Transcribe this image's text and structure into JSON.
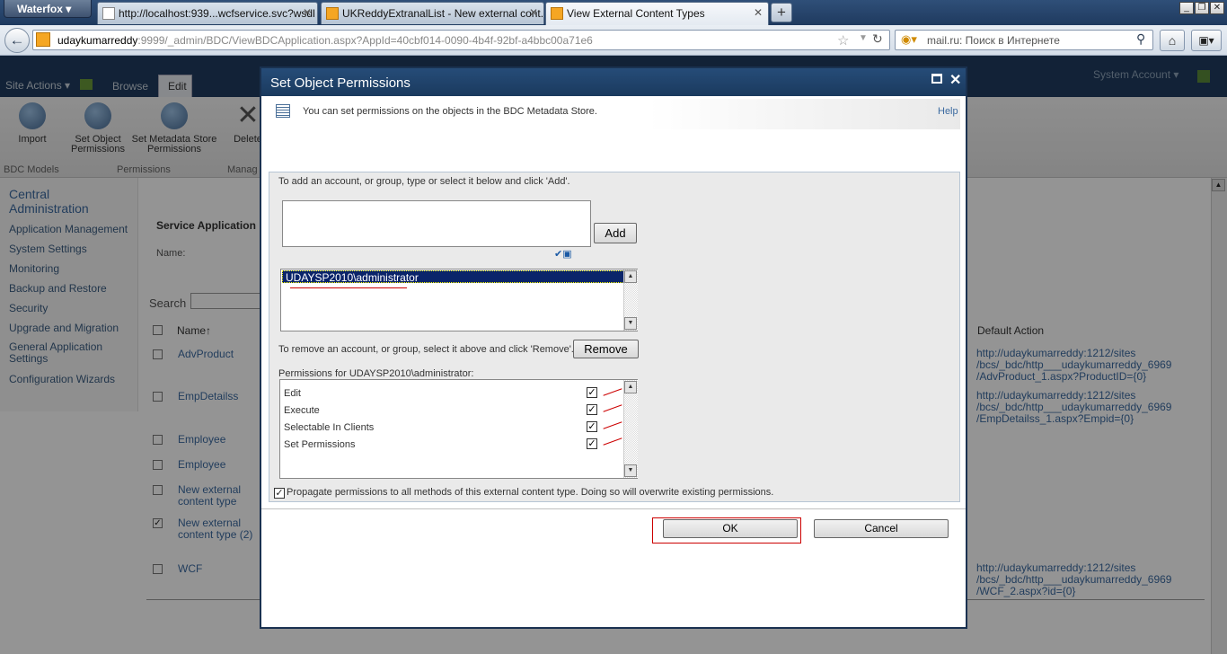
{
  "browser": {
    "app_name": "Waterfox",
    "tabs": [
      {
        "label": "http://localhost:939...wcfservice.svc?wsdl"
      },
      {
        "label": "UKReddyExtranalList - New external cont..."
      },
      {
        "label": "View External Content Types"
      }
    ],
    "url_host": "udaykumarreddy",
    "url_rest": ":9999/_admin/BDC/ViewBDCApplication.aspx?AppId=40cbf014-0090-4b4f-92bf-a4bbc00a71e6",
    "search_placeholder": "mail.ru: Поиск в Интернете"
  },
  "page": {
    "top_links": {
      "site_actions": "Site Actions ▾",
      "browse": "Browse",
      "edit": "Edit"
    },
    "system_account": "System Account ▾",
    "ribbon_buttons": [
      {
        "label": "Import"
      },
      {
        "label": "Set Object Permissions"
      },
      {
        "label": "Set Metadata Store Permissions"
      },
      {
        "label": "Delete"
      }
    ],
    "ribbon_groups": [
      "BDC Models",
      "Permissions",
      "Manag"
    ],
    "leftnav": {
      "heading": "Central Administration",
      "items": [
        "Application Management",
        "System Settings",
        "Monitoring",
        "Backup and Restore",
        "Security",
        "Upgrade and Migration",
        "General Application Settings",
        "Configuration Wizards"
      ]
    },
    "service_app_title": "Service Application I",
    "name_label": "Name:",
    "search_label": "Search",
    "column_name": "Name↑",
    "column_default_action": "Default Action",
    "rows": [
      {
        "name": "AdvProduct",
        "checked": false,
        "action": "http://udaykumarreddy:1212/sites/bcs/_bdc/http___udaykumarreddy_6969/AdvProduct_1.aspx?ProductID={0}"
      },
      {
        "name": "EmpDetailss",
        "checked": false,
        "action": "http://udaykumarreddy:1212/sites/bcs/_bdc/http___udaykumarreddy_6969/EmpDetailss_1.aspx?Empid={0}"
      },
      {
        "name": "Employee",
        "checked": false,
        "action": ""
      },
      {
        "name": "Employee",
        "checked": false,
        "action": ""
      },
      {
        "name": "New external content type",
        "checked": false,
        "action": ""
      },
      {
        "name": "New external content type (2)",
        "checked": true,
        "action": ""
      },
      {
        "name": "WCF",
        "checked": false,
        "action": "http://udaykumarreddy:1212/sites/bcs/_bdc/http___udaykumarreddy_6969/WCF_2.aspx?id={0}"
      }
    ],
    "action_lines": [
      [
        "http://udaykumarreddy:1212/sites",
        "/bcs/_bdc/http___udaykumarreddy_6969",
        "/AdvProduct_1.aspx?ProductID={0}"
      ],
      [
        "http://udaykumarreddy:1212/sites",
        "/bcs/_bdc/http___udaykumarreddy_6969",
        "/EmpDetailss_1.aspx?Empid={0}"
      ],
      [
        "http://udaykumarreddy:1212/sites",
        "/bcs/_bdc/http___udaykumarreddy_6969",
        "/WCF_2.aspx?id={0}"
      ]
    ]
  },
  "dialog": {
    "title": "Set Object Permissions",
    "info_text": "You can set permissions on the objects in the BDC Metadata Store.",
    "help_label": "Help",
    "add_instructions": "To add an account, or group, type or select it below and click 'Add'.",
    "account_input_value": "",
    "add_label": "Add",
    "users": [
      "UDAYSP2010\\administrator"
    ],
    "remove_instructions": "To remove an account, or group, select it above and click 'Remove'.",
    "remove_label": "Remove",
    "permissions_label": "Permissions for UDAYSP2010\\administrator:",
    "permissions": [
      {
        "label": "Edit",
        "checked": true
      },
      {
        "label": "Execute",
        "checked": true
      },
      {
        "label": "Selectable In Clients",
        "checked": true
      },
      {
        "label": "Set Permissions",
        "checked": true
      }
    ],
    "propagate_text": "Propagate permissions to all methods of this external content type. Doing so will overwrite existing permissions.",
    "propagate_checked": true,
    "ok_label": "OK",
    "cancel_label": "Cancel"
  },
  "colors": {
    "accent": "#1f3c60",
    "link": "#3b6aa0",
    "selection": "#0a246a",
    "highlight": "#cc0000"
  }
}
